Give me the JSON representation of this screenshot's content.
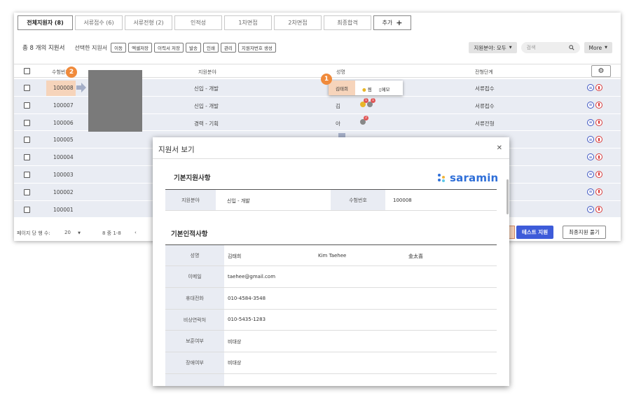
{
  "tabs": [
    {
      "label": "전체지원자 (8)"
    },
    {
      "label": "서류접수 (6)"
    },
    {
      "label": "서류전형 (2)"
    },
    {
      "label": "인적성"
    },
    {
      "label": "1차면접"
    },
    {
      "label": "2차면접"
    },
    {
      "label": "최종합격"
    },
    {
      "label": "추가"
    }
  ],
  "toolbar": {
    "total": "총 8 개의 지원서",
    "selected_label": "선택한 지원서",
    "buttons": [
      "이동",
      "엑셀저장",
      "이력서 저장",
      "발송",
      "인쇄",
      "관리",
      "지원자번호 생성"
    ],
    "filter": "지원분야: 모두",
    "search_placeholder": "검색",
    "more": "More"
  },
  "table": {
    "headers": {
      "number": "수험번호",
      "field": "지원분야",
      "name": "성명",
      "stage": "전형단계"
    },
    "rows": [
      {
        "number": "100008",
        "field": "신입 - 개발",
        "name": "",
        "stage": "서류접수"
      },
      {
        "number": "100007",
        "field": "신입 - 개발",
        "name": "김",
        "stage": "서류접수"
      },
      {
        "number": "100006",
        "field": "경력 - 기획",
        "name": "아",
        "stage": "서류전형"
      },
      {
        "number": "100005",
        "field": "",
        "name": "",
        "stage": ""
      },
      {
        "number": "100004",
        "field": "",
        "name": "",
        "stage": ""
      },
      {
        "number": "100003",
        "field": "",
        "name": "",
        "stage": ""
      },
      {
        "number": "100002",
        "field": "",
        "name": "",
        "stage": ""
      },
      {
        "number": "100001",
        "field": "",
        "name": "",
        "stage": ""
      }
    ]
  },
  "footer": {
    "rows_per_page_label": "페이지 당 행 수:",
    "rows_per_page": "20",
    "range": "8 중 1-8",
    "test_btn": "테스트 지원",
    "final_btn": "최종지원 풀기"
  },
  "popup": {
    "name": "김태희",
    "star": "찜",
    "memo": "메모"
  },
  "markers": {
    "one": "1",
    "two": "2"
  },
  "badges": {
    "row2_a": "1",
    "row2_b": "1",
    "row3": "2"
  },
  "modal": {
    "title": "지원서 보기",
    "section1": "기본지원사항",
    "logo": "saramin",
    "field_label": "지원분야",
    "field_value": "신입 - 개발",
    "number_label": "수험번호",
    "number_value": "100008",
    "section2": "기본인적사항",
    "name_label": "성명",
    "name_ko": "김태희",
    "name_en": "Kim Taehee",
    "name_cn": "金太喜",
    "email_label": "이메일",
    "email_value": "taehee@gmail.com",
    "mobile_label": "휴대전화",
    "mobile_value": "010-4584-3548",
    "emergency_label": "비상연락처",
    "emergency_value": "010-5435-1283",
    "veteran_label": "보훈여부",
    "veteran_value": "비대상",
    "disability_label": "장애여부",
    "disability_value": "비대상"
  },
  "colors": {
    "accent": "#3d5bd9",
    "highlight": "#f6d4bb",
    "marker": "#f08a3b",
    "logo": "#2f6fd8"
  }
}
